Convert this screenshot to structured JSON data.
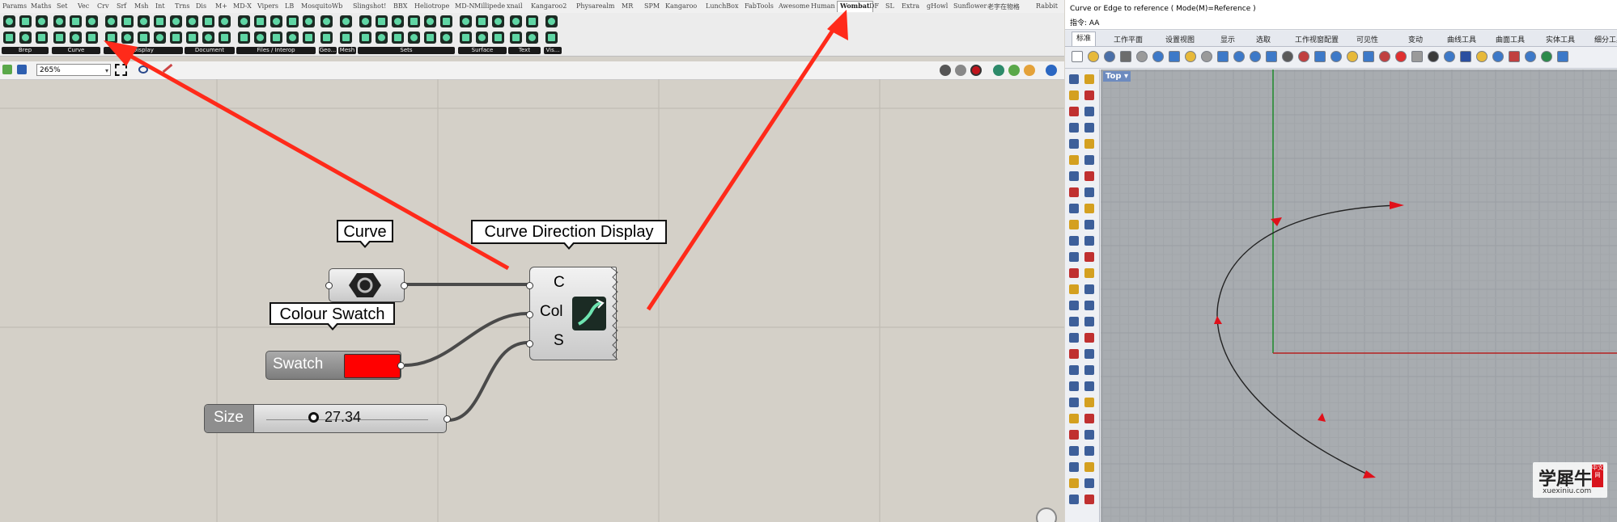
{
  "grasshopper": {
    "tabs": [
      "Params",
      "Maths",
      "Set",
      "Vec",
      "Crv",
      "Srf",
      "Msh",
      "Int",
      "Trns",
      "Dis",
      "M+",
      "MD-X",
      "Vipers",
      "LB",
      "Mosquito",
      "Wb",
      "Slingshot!",
      "BBX",
      "Heliotrope",
      "MD-N",
      "Millipede",
      "xnail",
      "Kangaroo2",
      "Physarealm",
      "MR",
      "SPM",
      "Kangaroo",
      "LunchBox",
      "FabTools",
      "Awesome",
      "Human",
      "Wombat",
      "DF",
      "SL",
      "Extra",
      "gHowl",
      "Sunflower",
      "老字在物格",
      "Rabbit"
    ],
    "active_tab": "Wombat",
    "ribbon_groups": [
      "Brep",
      "Curve",
      "Display",
      "Document",
      "Files / Interop",
      "Geo...",
      "Mesh",
      "Sets",
      "Surface",
      "Text",
      "Vis..."
    ],
    "zoom_value": "265%",
    "components": {
      "curve_param_label": "Curve",
      "swatch_label": "Colour Swatch",
      "swatch_name": "Swatch",
      "swatch_color": "#ff0000",
      "slider_name": "Size",
      "slider_value": "27.34",
      "main_label": "Curve Direction Display",
      "inputs": [
        "C",
        "Col",
        "S"
      ]
    }
  },
  "rhino": {
    "command_prompt": "Curve or Edge to reference ( Mode(M)=Reference )",
    "command_line": "指令: AA",
    "tabs": [
      "标准",
      "工作平面",
      "设置视图",
      "显示",
      "选取",
      "工作视窗配置",
      "可见性",
      "变动",
      "曲线工具",
      "曲面工具",
      "实体工具",
      "细分工具"
    ],
    "active_tab": "标准",
    "viewport_label": "Top",
    "watermark": {
      "name": "学犀牛",
      "badge": "中文网",
      "url": "xuexiniu.com"
    }
  },
  "colors": {
    "annotation_arrow": "#ff2a1a",
    "canvas": "#d4d0c8",
    "viewport": "#a8acb0",
    "curve_arrow": "#e0101a"
  }
}
